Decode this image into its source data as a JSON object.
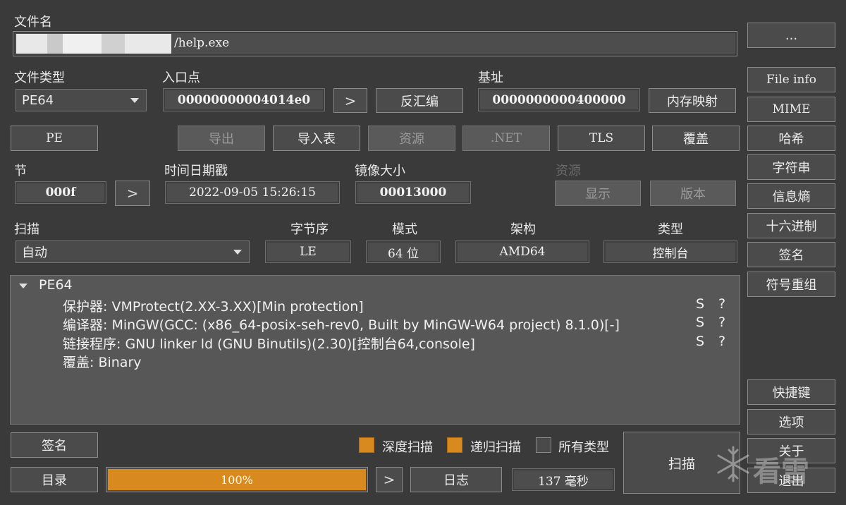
{
  "file": {
    "label": "文件名",
    "path": "/help.exe",
    "browse_label": "..."
  },
  "filetype": {
    "label": "文件类型",
    "value": "PE64"
  },
  "entry": {
    "label": "入口点",
    "value": "00000000004014e0",
    "go_label": ">",
    "disasm_label": "反汇编"
  },
  "base": {
    "label": "基址",
    "value": "0000000000400000",
    "memmap_label": "内存映射"
  },
  "row_buttons": {
    "pe": "PE",
    "export": "导出",
    "import": "导入表",
    "resources": "资源",
    "net": ".NET",
    "tls": "TLS",
    "overlay": "覆盖"
  },
  "sections": {
    "label": "节",
    "value": "000f",
    "go_label": ">"
  },
  "timestamp": {
    "label": "时间日期戳",
    "value": "2022-09-05 15:26:15"
  },
  "image_size": {
    "label": "镜像大小",
    "value": "00013000"
  },
  "resources_group": {
    "label": "资源",
    "show_label": "显示",
    "version_label": "版本"
  },
  "scan": {
    "label": "扫描",
    "value": "自动"
  },
  "endian": {
    "label": "字节序",
    "value": "LE"
  },
  "mode": {
    "label": "模式",
    "value": "64 位"
  },
  "arch": {
    "label": "架构",
    "value": "AMD64"
  },
  "type": {
    "label": "类型",
    "value": "控制台"
  },
  "results": {
    "root": "PE64",
    "lines": [
      {
        "text": "保护器: VMProtect(2.XX-3.XX)[Min protection]",
        "s": "S",
        "q": "?"
      },
      {
        "text": "编译器: MinGW(GCC: (x86_64-posix-seh-rev0, Built by MinGW-W64 project) 8.1.0)[-]",
        "s": "S",
        "q": "?"
      },
      {
        "text": "链接程序: GNU linker ld (GNU Binutils)(2.30)[控制台64,console]",
        "s": "S",
        "q": "?"
      },
      {
        "text": "覆盖: Binary",
        "s": "",
        "q": ""
      }
    ]
  },
  "side_buttons": {
    "file_info": "File info",
    "mime": "MIME",
    "hash": "哈希",
    "strings": "字符串",
    "entropy": "信息熵",
    "hex": "十六进制",
    "signature": "签名",
    "demangle": "符号重组",
    "shortcuts": "快捷键",
    "options": "选项",
    "about": "关于",
    "exit": "退出"
  },
  "bottom": {
    "signature_label": "签名",
    "directory_label": "目录",
    "progress": {
      "value": 100,
      "text": "100%",
      "color": "#d98a1e"
    },
    "next_label": ">",
    "log_label": "日志",
    "elapsed": "137 毫秒",
    "deep_scan": {
      "label": "深度扫描",
      "checked": true
    },
    "recursive_scan": {
      "label": "递归扫描",
      "checked": true
    },
    "all_types": {
      "label": "所有类型",
      "checked": false
    },
    "scan_button": "扫描"
  },
  "watermark": "看雪"
}
